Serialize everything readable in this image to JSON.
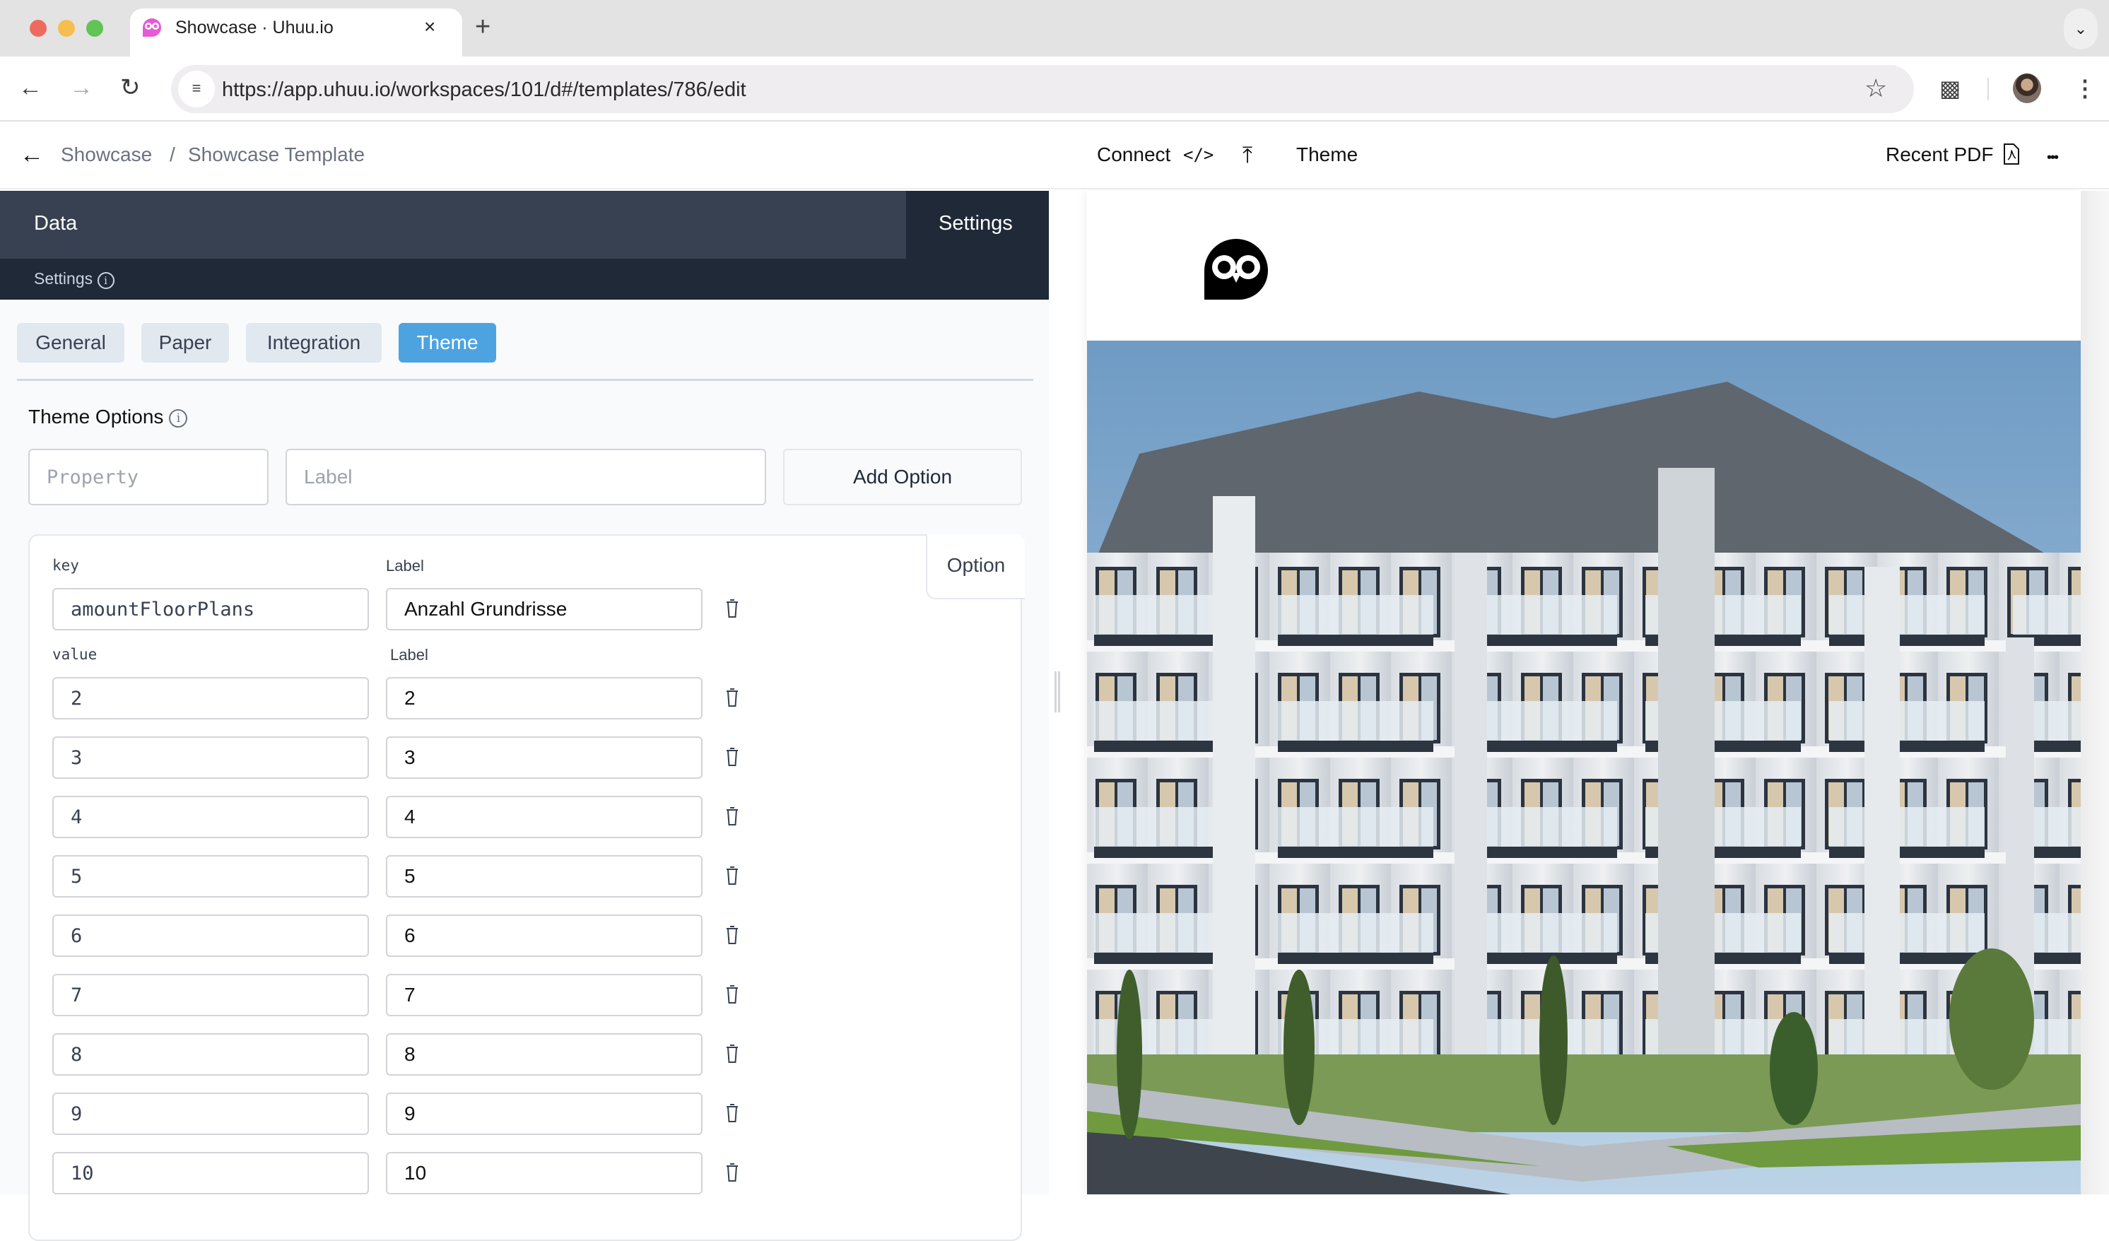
{
  "browser": {
    "tab_title": "Showcase · Uhuu.io",
    "tab_close_icon": "×",
    "new_tab_icon": "+",
    "tab_menu_icon": "⌄",
    "url": "https://app.uhuu.io/workspaces/101/d#/templates/786/edit",
    "colors": {
      "close": "#ee6a5f",
      "minimize": "#f5be4f",
      "maximize": "#61c454",
      "favicon": "#e45bd3"
    }
  },
  "app_header": {
    "breadcrumb": [
      "Showcase",
      "Showcase Template"
    ],
    "separator": "/",
    "connect_label": "Connect",
    "connect_icon": "</>",
    "publish_icon": "⤒",
    "theme_label": "Theme",
    "recent_pdf_label": "Recent PDF",
    "more_icon": "•••"
  },
  "left_panel": {
    "top_tabs": [
      {
        "label": "Data",
        "active": false
      },
      {
        "label": "Settings",
        "active": true
      }
    ],
    "subheader": "Settings",
    "settings_tabs": [
      {
        "label": "General",
        "active": false
      },
      {
        "label": "Paper",
        "active": false
      },
      {
        "label": "Integration",
        "active": false
      },
      {
        "label": "Theme",
        "active": true
      }
    ],
    "theme_options_title": "Theme Options",
    "property_placeholder": "Property",
    "label_placeholder": "Label",
    "add_option_label": "Add Option",
    "option_card": {
      "tab_label": "Option",
      "key_label": "key",
      "key_label_col2": "Label",
      "key_value": "amountFloorPlans",
      "key_label_value": "Anzahl Grundrisse",
      "value_label": "value",
      "value_label_col2": "Label",
      "values": [
        {
          "value": "2",
          "label": "2"
        },
        {
          "value": "3",
          "label": "3"
        },
        {
          "value": "4",
          "label": "4"
        },
        {
          "value": "5",
          "label": "5"
        },
        {
          "value": "6",
          "label": "6"
        },
        {
          "value": "7",
          "label": "7"
        },
        {
          "value": "8",
          "label": "8"
        },
        {
          "value": "9",
          "label": "9"
        },
        {
          "value": "10",
          "label": "10"
        }
      ]
    }
  },
  "colors": {
    "panel_dark": "#1f2937",
    "panel_tab": "#374151",
    "accent": "#4da3e0"
  }
}
